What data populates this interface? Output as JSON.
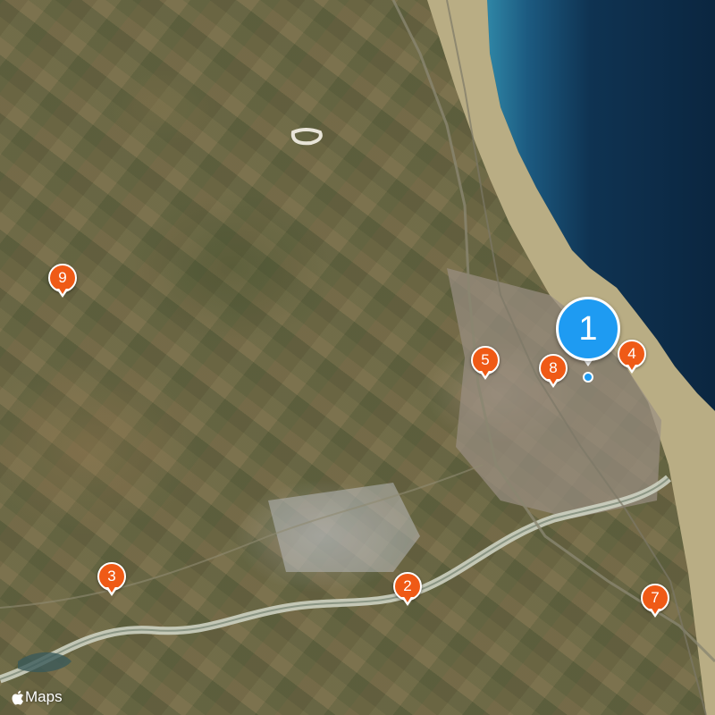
{
  "map": {
    "attribution": "Maps",
    "attribution_logo": "apple-logo-icon",
    "colors": {
      "sea_deep": "#0d2a45",
      "sea_shallow": "#2b7fa3",
      "beach": "#cdbf95",
      "river": "#cfd3c6",
      "pin_primary": "#1e9bf2",
      "pin_secondary": "#ef5a16"
    }
  },
  "pins": [
    {
      "label": "1",
      "type": "selected"
    },
    {
      "label": "2"
    },
    {
      "label": "3"
    },
    {
      "label": "4"
    },
    {
      "label": "5"
    },
    {
      "label": "7"
    },
    {
      "label": "8"
    },
    {
      "label": "9"
    }
  ]
}
